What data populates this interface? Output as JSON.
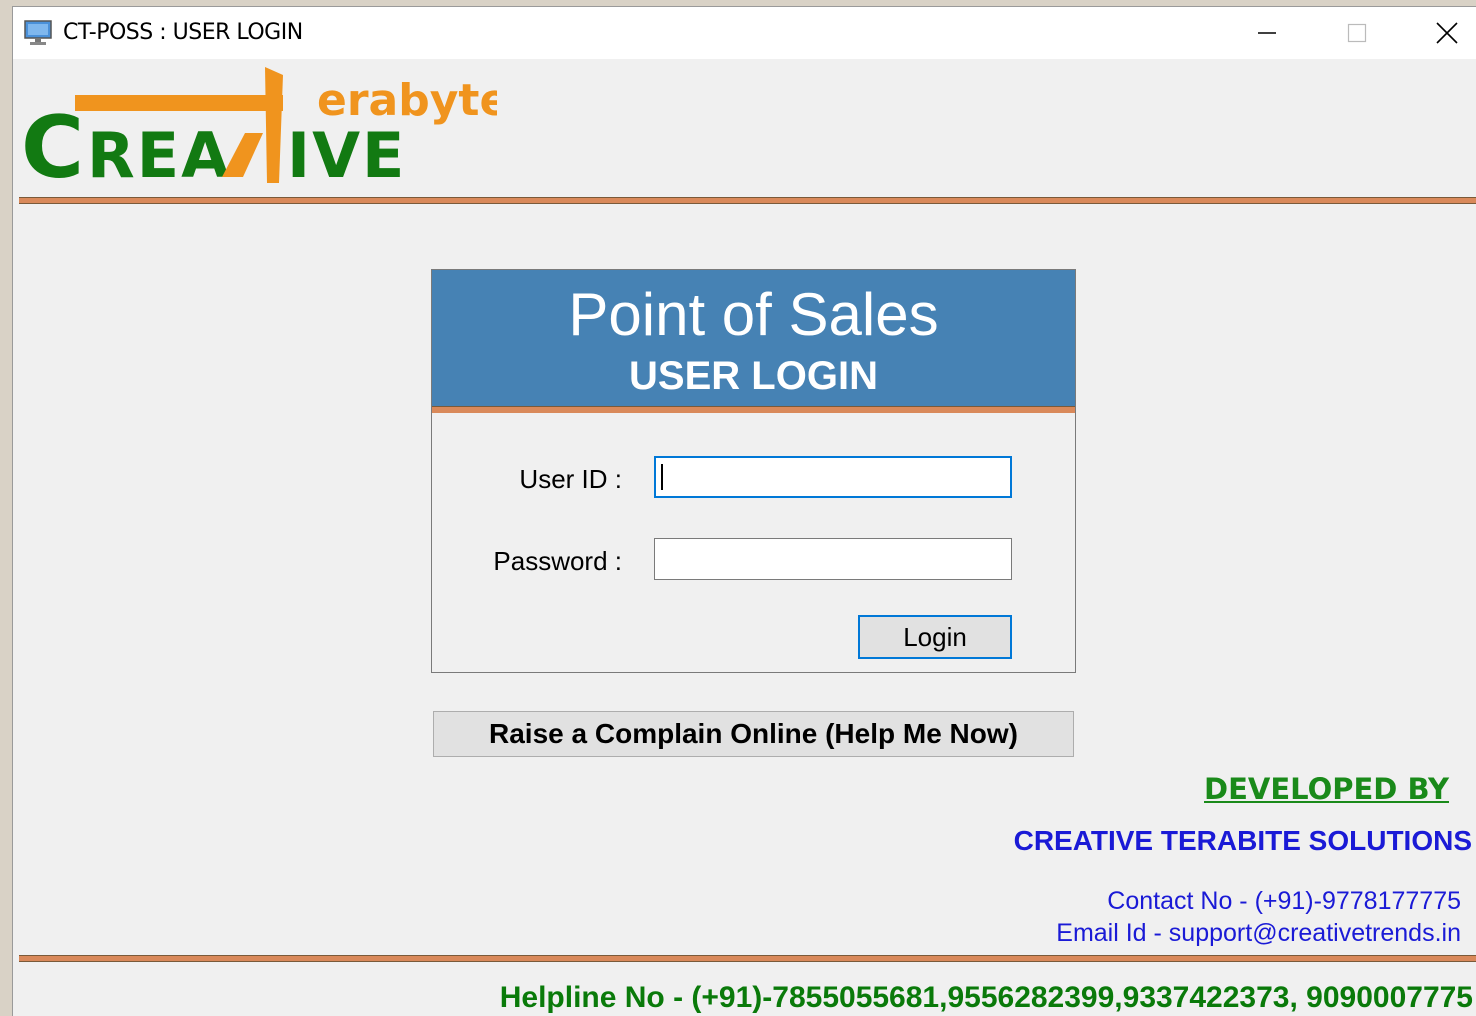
{
  "window": {
    "title": "CT-POSS : USER LOGIN",
    "controls": {
      "minimize": "minimize-icon",
      "maximize": "maximize-icon",
      "close": "close-icon"
    }
  },
  "logo": {
    "main_text": "CREATIVE",
    "sub_text": "erabyte",
    "colors": {
      "green": "#127a12",
      "orange": "#f0941e"
    }
  },
  "login": {
    "title": "Point of Sales",
    "subtitle": "USER LOGIN",
    "user_label": "User ID :",
    "password_label": "Password :",
    "user_value": "",
    "password_value": "",
    "login_button": "Login"
  },
  "complain_button": "Raise a Complain Online (Help Me Now)",
  "footer": {
    "developed_by": "DEVELOPED BY",
    "company": "CREATIVE TERABITE SOLUTIONS",
    "contact": "Contact No - (+91)-9778177775",
    "email": "Email Id - support@creativetrends.in",
    "helpline": "Helpline No - (+91)-7855055681,9556282399,9337422373, 9090007775"
  },
  "colors": {
    "header_blue": "#4682b4",
    "separator": "#d9895a",
    "link_blue": "#1a1ad6",
    "green_text": "#1a8a1a",
    "focus_blue": "#0078d7"
  }
}
